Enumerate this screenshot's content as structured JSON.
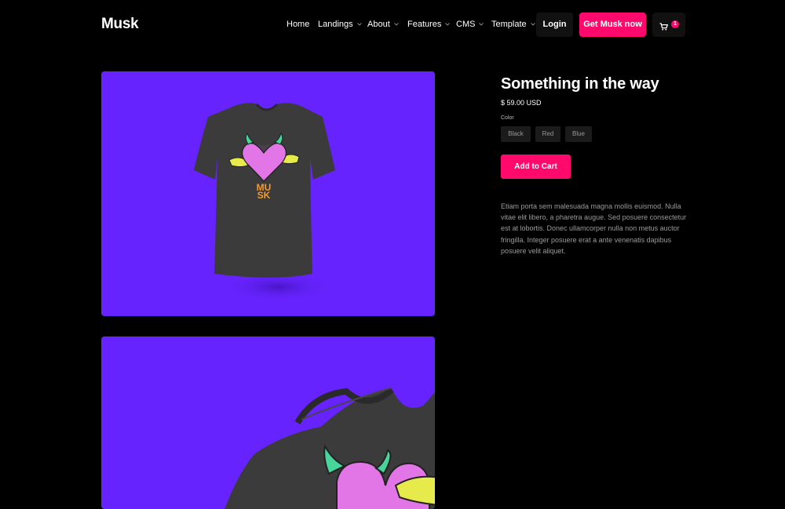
{
  "brand": {
    "name": "Musk"
  },
  "nav": {
    "items": [
      {
        "label": "Home",
        "dropdown": false
      },
      {
        "label": "Landings",
        "dropdown": true
      },
      {
        "label": "About",
        "dropdown": true
      },
      {
        "label": "Features",
        "dropdown": true
      },
      {
        "label": "CMS",
        "dropdown": true
      },
      {
        "label": "Template",
        "dropdown": true
      }
    ],
    "login_label": "Login",
    "cta_label": "Get Musk now",
    "cart_count": "1"
  },
  "product": {
    "title": "Something in the way",
    "price": "$ 59.00 USD",
    "color_label": "Color",
    "colors": [
      "Black",
      "Red",
      "Blue"
    ],
    "add_to_cart_label": "Add to Cart",
    "description": "Etiam porta sem malesuada magna mollis euismod. Nulla vitae elit libero, a pharetra augue. Sed posuere consectetur est at lobortis. Donec ullamcorper nulla non metus auctor fringilla. Integer posuere erat a ante venenatis dapibus posuere velit aliquet.",
    "shirt_print": "MU SK"
  },
  "colors": {
    "background": "#000000",
    "accent": "#ff0a6c",
    "image_background": "#6623fd",
    "shirt": "#3a3a3a",
    "heart": "#e376e6",
    "horns": "#47d59b",
    "wings": "#e6ea4a",
    "print_text": "#f39a32"
  },
  "icons": {
    "cart": "cart-icon",
    "dropdown": "chevron-down-icon"
  }
}
